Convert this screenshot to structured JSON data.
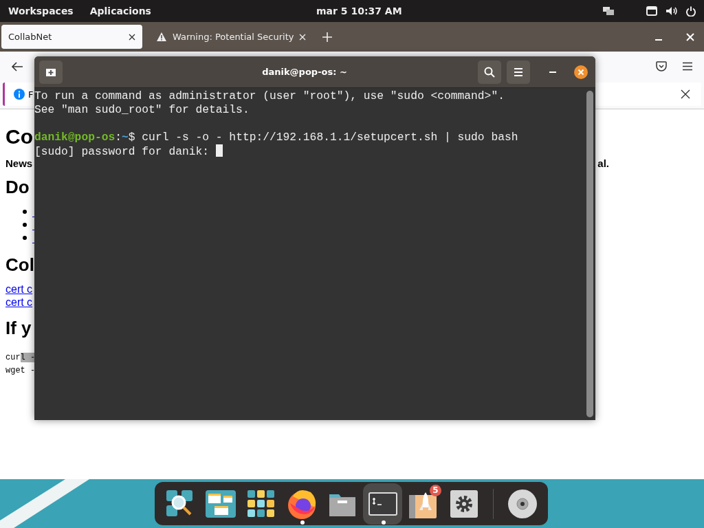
{
  "top_bar": {
    "menus": [
      "Workspaces",
      "Aplicacions"
    ],
    "clock": "mar 5  10:37 AM"
  },
  "browser": {
    "tabs": [
      {
        "label": "CollabNet",
        "selected": true,
        "kind": "page"
      },
      {
        "label": "Warning: Potential Security",
        "selected": false,
        "kind": "warning"
      }
    ],
    "notification": {
      "text": "F"
    },
    "page": [
      {
        "kind": "h1",
        "text": "Co"
      },
      {
        "kind": "split",
        "left": "News",
        "right": "al."
      },
      {
        "kind": "h2",
        "text": "Do"
      },
      {
        "kind": "bullets",
        "items": [
          {
            "kind": "link"
          },
          {
            "kind": "link"
          },
          {
            "kind": "link"
          }
        ]
      },
      {
        "kind": "h2",
        "text": "Col"
      },
      {
        "kind": "links",
        "items": [
          "cert c",
          "cert c"
        ]
      },
      {
        "kind": "h2",
        "text": "If y"
      },
      {
        "kind": "code",
        "lines": [
          {
            "text": "cur",
            "selected_text": "l -"
          },
          {
            "text": "wget -"
          }
        ]
      }
    ]
  },
  "terminal": {
    "title": "danik@pop-os: ~",
    "lines": [
      {
        "kind": "output",
        "text": "To run a command as administrator (user \"root\"), use \"sudo <command>\"."
      },
      {
        "kind": "output",
        "text": "See \"man sudo_root\" for details."
      },
      {
        "kind": "blank"
      },
      {
        "kind": "prompt",
        "user": "danik@pop-os",
        "sep": ":",
        "path": "~",
        "command": "$ curl -s -o - http://192.168.1.1/setupcert.sh | sudo bash"
      },
      {
        "kind": "input",
        "text": "[sudo] password for danik: ",
        "cursor": true
      }
    ]
  },
  "dock": [
    {
      "kind": "search",
      "selected": false,
      "running": false
    },
    {
      "kind": "windows",
      "selected": false,
      "running": false
    },
    {
      "kind": "grid",
      "selected": false,
      "running": false
    },
    {
      "kind": "firefox",
      "selected": false,
      "running": true
    },
    {
      "kind": "files",
      "selected": false,
      "running": false
    },
    {
      "kind": "terminal",
      "selected": true,
      "running": true
    },
    {
      "kind": "rocket",
      "selected": false,
      "running": false,
      "badge": "5"
    },
    {
      "kind": "settings",
      "selected": false,
      "running": false
    },
    {
      "kind": "separator"
    },
    {
      "kind": "disk",
      "selected": false,
      "running": false
    }
  ]
}
